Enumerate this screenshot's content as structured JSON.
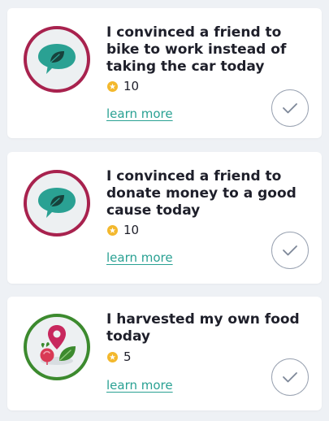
{
  "actions": [
    {
      "title": "I convinced a friend to bike to work instead of taking the car today",
      "points": "10",
      "link": "learn more",
      "icon": "speech-bubble-leaf-icon"
    },
    {
      "title": "I convinced a friend to donate money to a good cause today",
      "points": "10",
      "link": "learn more",
      "icon": "speech-bubble-leaf-icon"
    },
    {
      "title": "I harvested my own food today",
      "points": "5",
      "link": "learn more",
      "icon": "map-pin-radish-leaf-icon"
    }
  ],
  "colors": {
    "teal": "#2aa193",
    "maroon": "#a8224e",
    "green": "#3c8a2e",
    "coin": "#f3b82d",
    "check": "#9aa3b2"
  }
}
